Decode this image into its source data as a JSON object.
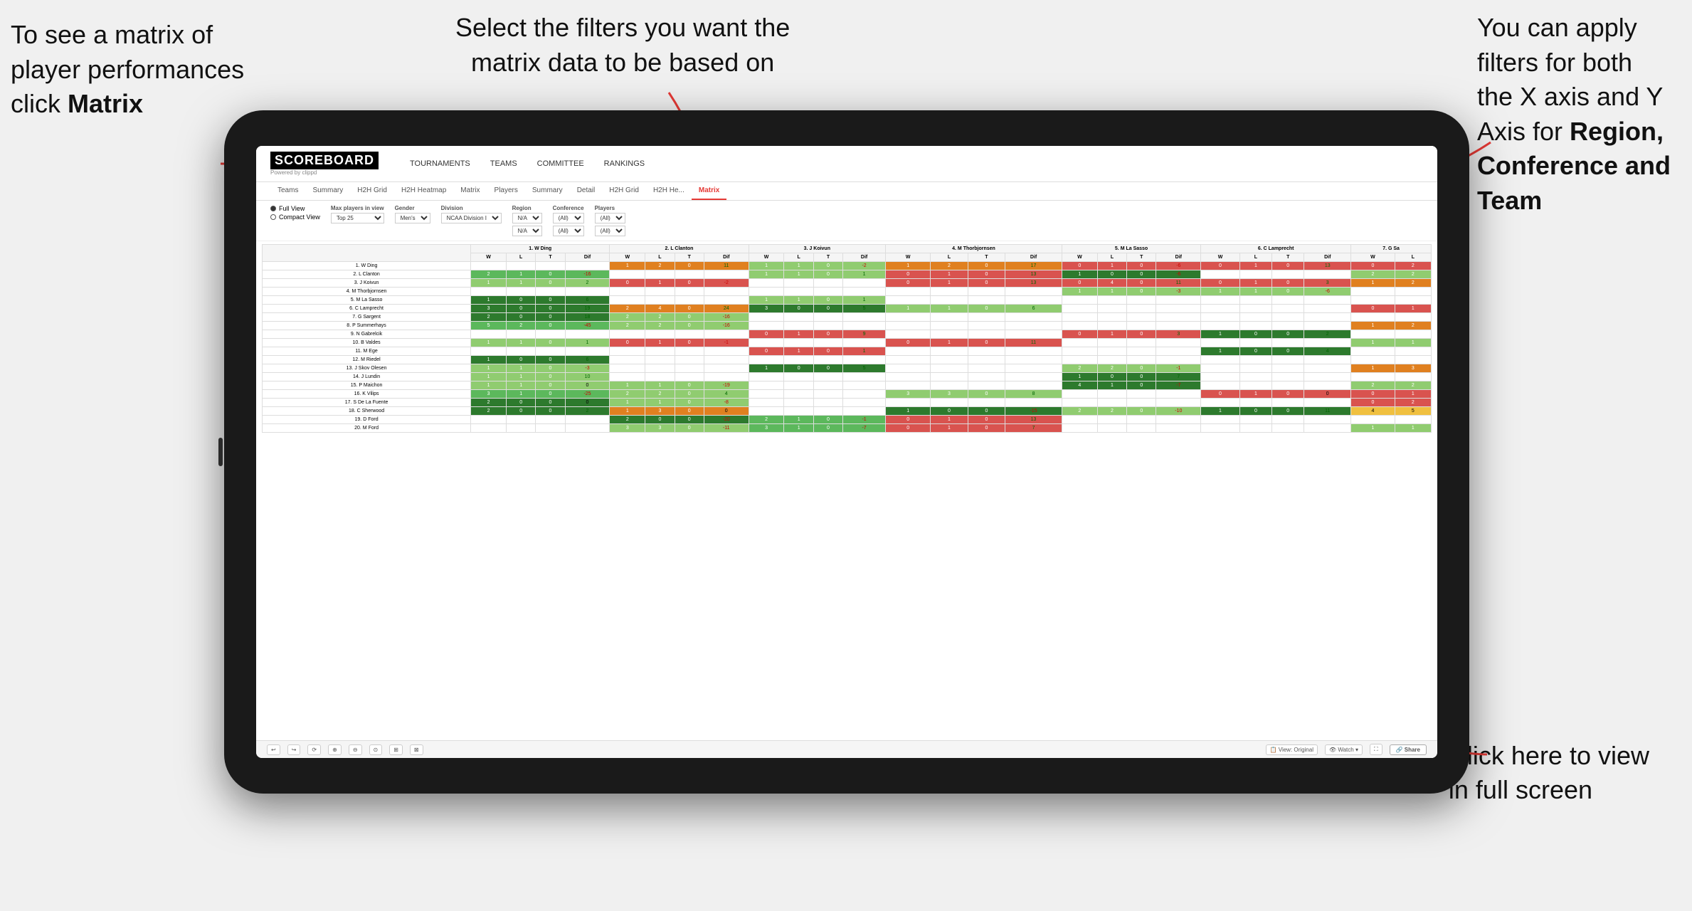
{
  "annotations": {
    "top_left": {
      "line1": "To see a matrix of",
      "line2": "player performances",
      "line3": "click ",
      "bold": "Matrix"
    },
    "top_center": {
      "line1": "Select the filters you want the",
      "line2": "matrix data to be based on"
    },
    "top_right": {
      "line1": "You  can apply",
      "line2": "filters for both",
      "line3": "the X axis and Y",
      "line4": "Axis for ",
      "bold1": "Region,",
      "line5": "",
      "bold2": "Conference and",
      "line6": "",
      "bold3": "Team"
    },
    "bottom_right": {
      "line1": "Click here to view",
      "line2": "in full screen"
    }
  },
  "app": {
    "logo": "SCOREBOARD",
    "logo_sub": "Powered by clippd",
    "nav": [
      "TOURNAMENTS",
      "TEAMS",
      "COMMITTEE",
      "RANKINGS"
    ],
    "sub_tabs": [
      "Teams",
      "Summary",
      "H2H Grid",
      "H2H Heatmap",
      "Matrix",
      "Players",
      "Summary",
      "Detail",
      "H2H Grid",
      "H2H He...",
      "Matrix"
    ],
    "active_tab": "Matrix",
    "filters": {
      "view_options": [
        "Full View",
        "Compact View"
      ],
      "max_players": {
        "label": "Max players in view",
        "value": "Top 25"
      },
      "gender": {
        "label": "Gender",
        "value": "Men's"
      },
      "division": {
        "label": "Division",
        "value": "NCAA Division I"
      },
      "region": {
        "label": "Region",
        "value": "N/A",
        "value2": "N/A"
      },
      "conference": {
        "label": "Conference",
        "value": "(All)",
        "value2": "(All)"
      },
      "players": {
        "label": "Players",
        "value": "(All)",
        "value2": "(All)"
      }
    },
    "col_headers": [
      "1. W Ding",
      "2. L Clanton",
      "3. J Koivun",
      "4. M Thorbjornsen",
      "5. M La Sasso",
      "6. C Lamprecht",
      "7. G Sa"
    ],
    "sub_col_headers": [
      "W",
      "L",
      "T",
      "Dif"
    ],
    "rows": [
      {
        "name": "1. W Ding",
        "cells": [
          [],
          [
            1,
            2,
            0,
            11
          ],
          [
            1,
            1,
            0,
            -2
          ],
          [
            1,
            2,
            0,
            17
          ],
          [
            0,
            1,
            0,
            -6
          ],
          [
            0,
            1,
            0,
            13
          ],
          [
            0,
            2
          ]
        ]
      },
      {
        "name": "2. L Clanton",
        "cells": [
          [
            2,
            1,
            0,
            -16
          ],
          [],
          [
            1,
            1,
            0,
            1
          ],
          [
            0,
            1,
            0,
            13
          ],
          [
            1,
            0,
            0,
            -6
          ],
          [],
          [
            2,
            2
          ]
        ]
      },
      {
        "name": "3. J Koivun",
        "cells": [
          [
            1,
            1,
            0,
            2
          ],
          [
            0,
            1,
            0,
            -2
          ],
          [],
          [
            0,
            1,
            0,
            13
          ],
          [
            0,
            4,
            0,
            11
          ],
          [
            0,
            1,
            0,
            3
          ],
          [
            1,
            2
          ]
        ]
      },
      {
        "name": "4. M Thorbjornsen",
        "cells": [
          [],
          [],
          [],
          [],
          [
            1,
            1,
            0,
            -3
          ],
          [
            1,
            1,
            0,
            -6
          ],
          []
        ]
      },
      {
        "name": "5. M La Sasso",
        "cells": [
          [
            1,
            0,
            0,
            6
          ],
          [],
          [
            1,
            1,
            0,
            1
          ],
          [],
          [],
          [],
          []
        ]
      },
      {
        "name": "6. C Lamprecht",
        "cells": [
          [
            3,
            0,
            0,
            19
          ],
          [
            2,
            4,
            0,
            24
          ],
          [
            3,
            0,
            0,
            5
          ],
          [
            1,
            1,
            0,
            6
          ],
          [],
          [],
          [
            0,
            1
          ]
        ]
      },
      {
        "name": "7. G Sargent",
        "cells": [
          [
            2,
            0,
            0,
            18
          ],
          [
            2,
            2,
            0,
            -16
          ],
          [],
          [],
          [],
          [],
          []
        ]
      },
      {
        "name": "8. P Summerhays",
        "cells": [
          [
            5,
            2,
            0,
            -45
          ],
          [
            2,
            2,
            0,
            -16
          ],
          [],
          [],
          [],
          [],
          [
            1,
            2
          ]
        ]
      },
      {
        "name": "9. N Gabrelcik",
        "cells": [
          [],
          [],
          [
            0,
            1,
            0,
            9
          ],
          [],
          [
            0,
            1,
            0,
            3
          ],
          [
            1,
            0,
            0,
            2
          ],
          []
        ]
      },
      {
        "name": "10. B Valdes",
        "cells": [
          [
            1,
            1,
            0,
            1
          ],
          [
            0,
            1,
            0,
            -1
          ],
          [],
          [
            0,
            1,
            0,
            11
          ],
          [],
          [],
          [
            1,
            1
          ]
        ]
      },
      {
        "name": "11. M Ege",
        "cells": [
          [],
          [],
          [
            0,
            1,
            0,
            1
          ],
          [],
          [],
          [
            1,
            0,
            0,
            4
          ],
          []
        ]
      },
      {
        "name": "12. M Riedel",
        "cells": [
          [
            1,
            0,
            0,
            6
          ],
          [],
          [],
          [],
          [],
          [],
          []
        ]
      },
      {
        "name": "13. J Skov Olesen",
        "cells": [
          [
            1,
            1,
            0,
            -3
          ],
          [],
          [
            1,
            0,
            0,
            5
          ],
          [],
          [
            2,
            2,
            0,
            -1
          ],
          [],
          [
            1,
            3
          ]
        ]
      },
      {
        "name": "14. J Lundin",
        "cells": [
          [
            1,
            1,
            0,
            10
          ],
          [],
          [],
          [],
          [
            1,
            0,
            0,
            7
          ],
          [],
          []
        ]
      },
      {
        "name": "15. P Maichon",
        "cells": [
          [
            1,
            1,
            0,
            0
          ],
          [
            1,
            1,
            0,
            -19
          ],
          [],
          [],
          [
            4,
            1,
            0,
            -7
          ],
          [],
          [
            2,
            2
          ]
        ]
      },
      {
        "name": "16. K Vilips",
        "cells": [
          [
            3,
            1,
            0,
            -25
          ],
          [
            2,
            2,
            0,
            4
          ],
          [],
          [
            3,
            3,
            0,
            8
          ],
          [],
          [
            0,
            1,
            0,
            0
          ],
          [
            0,
            1
          ]
        ]
      },
      {
        "name": "17. S De La Fuente",
        "cells": [
          [
            2,
            0,
            0,
            0
          ],
          [
            1,
            1,
            0,
            -8
          ],
          [],
          [],
          [],
          [],
          [
            0,
            2
          ]
        ]
      },
      {
        "name": "18. C Sherwood",
        "cells": [
          [
            2,
            0,
            0,
            2
          ],
          [
            1,
            3,
            0,
            0
          ],
          [],
          [
            1,
            0,
            0,
            -15
          ],
          [
            2,
            2,
            0,
            -10
          ],
          [
            1,
            0,
            0,
            11
          ],
          [
            4,
            5
          ]
        ]
      },
      {
        "name": "19. D Ford",
        "cells": [
          [],
          [
            2,
            0,
            0,
            -20
          ],
          [
            2,
            1,
            0,
            -1
          ],
          [
            0,
            1,
            0,
            13
          ],
          [],
          [],
          []
        ]
      },
      {
        "name": "20. M Ford",
        "cells": [
          [],
          [
            3,
            3,
            0,
            -11
          ],
          [
            3,
            1,
            0,
            -7
          ],
          [
            0,
            1,
            0,
            7
          ],
          [],
          [],
          [
            1,
            1
          ]
        ]
      }
    ],
    "bottom_toolbar": {
      "tools": [
        "↩",
        "↪",
        "⟳",
        "⊕",
        "⊖",
        "⊙",
        "⊞",
        "⊠"
      ],
      "view_label": "View: Original",
      "watch_label": "Watch ▾",
      "share_label": "Share"
    }
  }
}
